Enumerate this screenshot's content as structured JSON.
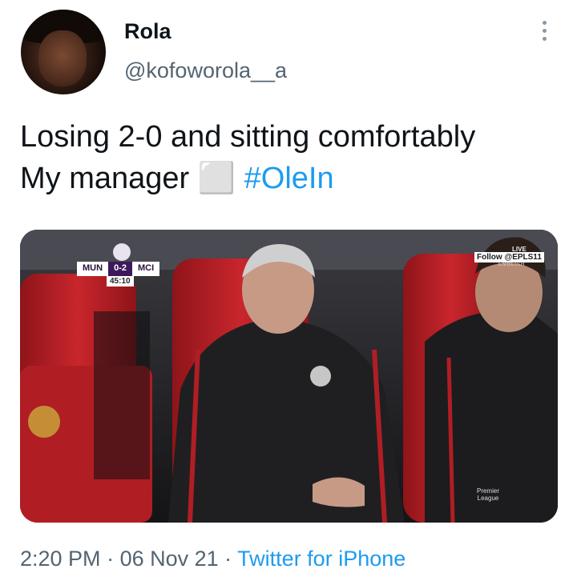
{
  "tweet": {
    "display_name": "Rola",
    "handle": "@kofoworola__a",
    "text_line1": "Losing 2-0 and sitting comfortably",
    "text_line2_prefix": "My manager ⬜ ",
    "hashtag": "#OleIn",
    "time": "2:20 PM",
    "separator": " · ",
    "date": "06 Nov 21",
    "source": "Twitter for iPhone"
  },
  "media": {
    "scoreboard": {
      "home": "MUN",
      "score": "0-2",
      "away": "MCI",
      "clock": "45:10"
    },
    "overlay": {
      "live": "LIVE",
      "follow": "Follow @EPLS11",
      "language": "ENGLISH",
      "league_line1": "Premier",
      "league_line2": "League"
    }
  },
  "icons": {
    "more": "more-vertical-icon"
  },
  "colors": {
    "link": "#1d9bf0",
    "secondary": "#536471",
    "seat_red": "#b31f25"
  }
}
